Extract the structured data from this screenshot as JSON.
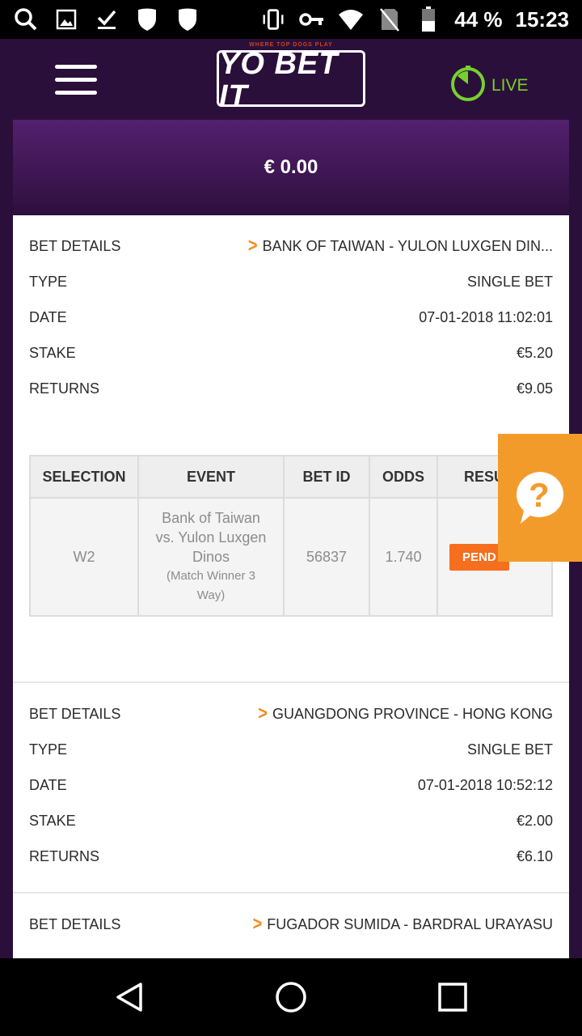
{
  "status_bar": {
    "battery": "44 %",
    "time": "15:23"
  },
  "header": {
    "logo_tagline": "WHERE TOP DOGS PLAY",
    "logo_text": "YO BET IT",
    "live_label": "LIVE"
  },
  "balance": "€ 0.00",
  "bets": [
    {
      "details_label": "BET DETAILS",
      "event_name": "BANK OF TAIWAN - YULON LUXGEN DIN...",
      "type_label": "TYPE",
      "type_value": "SINGLE BET",
      "date_label": "DATE",
      "date_value": "07-01-2018 11:02:01",
      "stake_label": "STAKE",
      "stake_value": "€5.20",
      "returns_label": "RETURNS",
      "returns_value": "€9.05"
    },
    {
      "details_label": "BET DETAILS",
      "event_name": "GUANGDONG PROVINCE - HONG KONG",
      "type_label": "TYPE",
      "type_value": "SINGLE BET",
      "date_label": "DATE",
      "date_value": "07-01-2018 10:52:12",
      "stake_label": "STAKE",
      "stake_value": "€2.00",
      "returns_label": "RETURNS",
      "returns_value": "€6.10"
    },
    {
      "details_label": "BET DETAILS",
      "event_name": "FUGADOR SUMIDA - BARDRAL URAYASU"
    }
  ],
  "selection_table": {
    "headers": [
      "SELECTION",
      "EVENT",
      "BET ID",
      "ODDS",
      "RESU"
    ],
    "row": {
      "selection": "W2",
      "event_line1": "Bank of Taiwan",
      "event_line2": "vs. Yulon Luxgen",
      "event_line3": "Dinos",
      "market_line1": "(Match Winner 3",
      "market_line2": "Way)",
      "bet_id": "56837",
      "odds": "1.740",
      "result": "PEND"
    }
  },
  "help_button": "?"
}
